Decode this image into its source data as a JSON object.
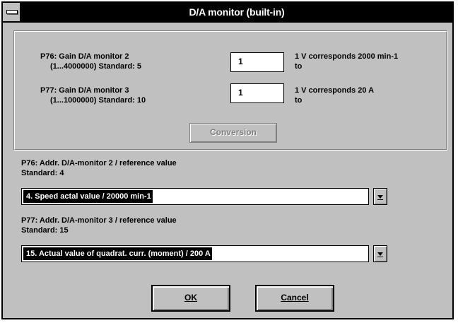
{
  "window": {
    "title": "D/A monitor (built-in)"
  },
  "group": {
    "p76_line1": "P76: Gain D/A monitor 2",
    "p76_line2": "(1...4000000)  Standard: 5",
    "p76_value": "1",
    "p76_note_line1": "1 V corresponds  2000 min-1",
    "p76_note_line2": "to",
    "p77_line1": "P77: Gain D/A monitor 3",
    "p77_line2": "(1...1000000)  Standard: 10",
    "p77_value": "1",
    "p77_note_line1": "1 V corresponds  20 A",
    "p77_note_line2": "to",
    "conversion_label": "Conversion"
  },
  "section76": {
    "line1": "P76: Addr. D/A-monitor 2  /  reference value",
    "line2": "Standard: 4",
    "selected": "4. Speed actal value  /  20000 min-1"
  },
  "section77": {
    "line1": "P77: Addr. D/A-monitor 3  /  reference value",
    "line2": "Standard: 15",
    "selected": "15. Actual value of quadrat. curr. (moment)  /  200 A"
  },
  "buttons": {
    "ok": "OK",
    "cancel": "Cancel"
  }
}
